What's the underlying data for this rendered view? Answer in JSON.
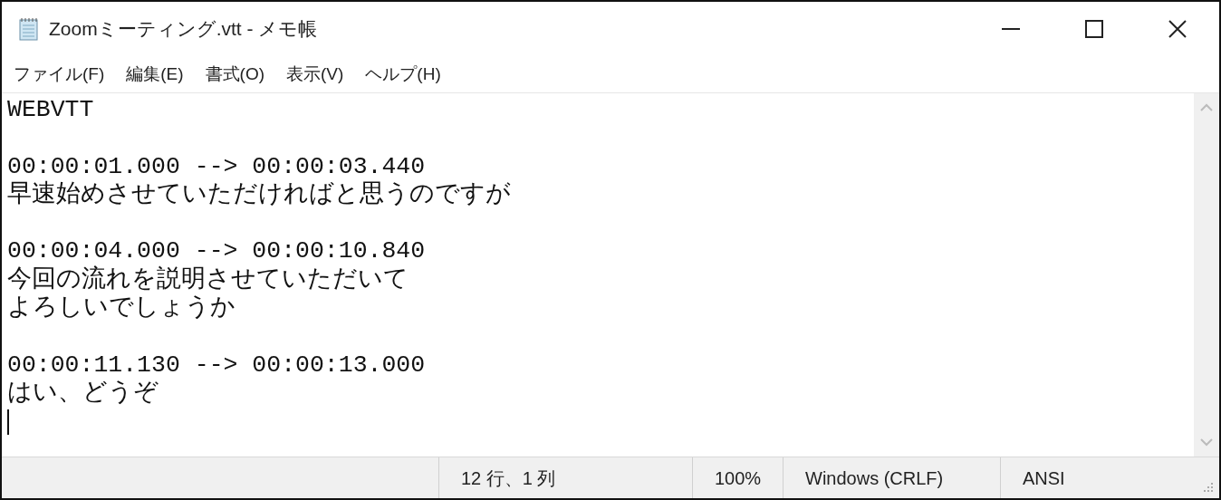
{
  "window": {
    "title": "Zoomミーティング.vtt - メモ帳"
  },
  "menu": [
    "ファイル(F)",
    "編集(E)",
    "書式(O)",
    "表示(V)",
    "ヘルプ(H)"
  ],
  "editor": {
    "header": "WEBVTT",
    "cues": [
      {
        "timing": "00:00:01.000 --> 00:00:03.440",
        "lines": [
          "早速始めさせていただければと思うのですが"
        ]
      },
      {
        "timing": "00:00:04.000 --> 00:00:10.840",
        "lines": [
          "今回の流れを説明させていただいて",
          "よろしいでしょうか"
        ]
      },
      {
        "timing": "00:00:11.130 --> 00:00:13.000",
        "lines": [
          "はい、どうぞ"
        ]
      }
    ]
  },
  "status_bar": {
    "position": "12 行、1 列",
    "zoom": "100%",
    "line_ending": "Windows (CRLF)",
    "encoding": "ANSI"
  }
}
